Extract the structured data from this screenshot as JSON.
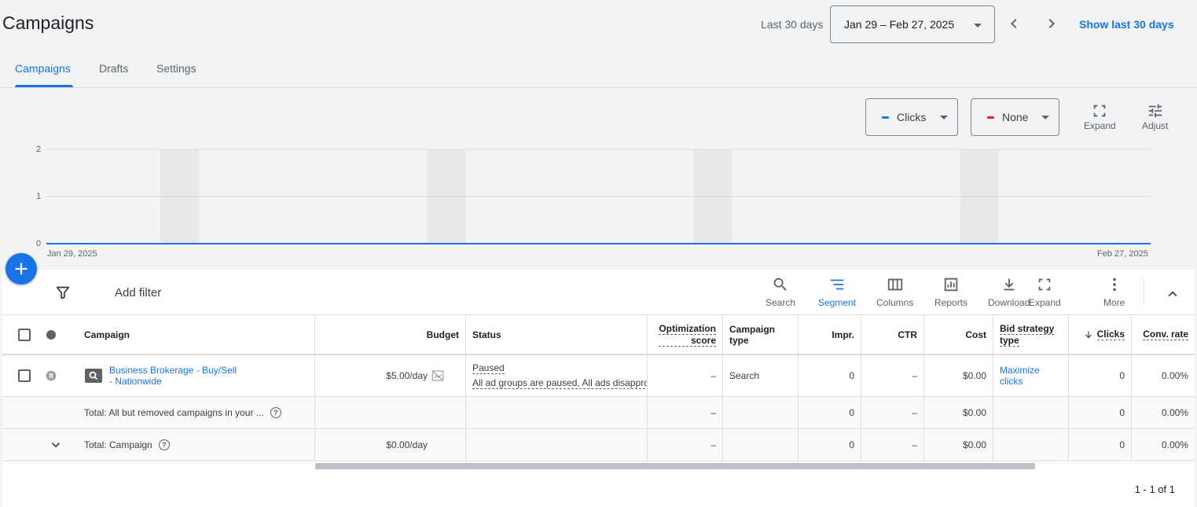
{
  "header": {
    "title": "Campaigns",
    "date_label": "Last 30 days",
    "date_range": "Jan 29 – Feb 27, 2025",
    "show_last": "Show last 30 days"
  },
  "tabs": [
    {
      "label": "Campaigns",
      "active": true
    },
    {
      "label": "Drafts",
      "active": false
    },
    {
      "label": "Settings",
      "active": false
    }
  ],
  "chart_controls": {
    "metric1": {
      "label": "Clicks",
      "color": "#1a73e8"
    },
    "metric2": {
      "label": "None",
      "color": "#d93025"
    },
    "expand_label": "Expand",
    "adjust_label": "Adjust"
  },
  "chart_data": {
    "type": "line",
    "x_start": "Jan 29, 2025",
    "x_end": "Feb 27, 2025",
    "y_ticks": [
      "2",
      "1",
      "0"
    ],
    "ylim": [
      0,
      2
    ],
    "series": [
      {
        "name": "Clicks",
        "color": "#1a73e8",
        "values": [
          0,
          0,
          0,
          0,
          0,
          0,
          0,
          0,
          0,
          0,
          0,
          0,
          0,
          0,
          0,
          0,
          0,
          0,
          0,
          0,
          0,
          0,
          0,
          0,
          0,
          0,
          0,
          0,
          0,
          0
        ]
      }
    ],
    "weekend_shading": true
  },
  "toolbar": {
    "add_filter": "Add filter",
    "buttons": [
      {
        "label": "Search",
        "icon": "search-icon"
      },
      {
        "label": "Segment",
        "icon": "segment-icon",
        "active": true
      },
      {
        "label": "Columns",
        "icon": "columns-icon"
      },
      {
        "label": "Reports",
        "icon": "reports-icon"
      },
      {
        "label": "Download",
        "icon": "download-icon"
      },
      {
        "label": "Expand",
        "icon": "expand-icon"
      },
      {
        "label": "More",
        "icon": "more-vert-icon"
      }
    ]
  },
  "table": {
    "headers": {
      "campaign": "Campaign",
      "budget": "Budget",
      "status": "Status",
      "opt_score_1": "Optimization",
      "opt_score_2": "score",
      "campaign_type_1": "Campaign",
      "campaign_type_2": "type",
      "impr": "Impr.",
      "ctr": "CTR",
      "cost": "Cost",
      "bid_1": "Bid strategy",
      "bid_2": "type",
      "clicks": "Clicks",
      "conv_rate": "Conv. rate"
    },
    "row": {
      "campaign_1": "Business Brokerage - Buy/Sell",
      "campaign_2": "- Nationwide",
      "budget": "$5.00/day",
      "status": "Paused",
      "status_detail": "All ad groups are paused, All ads disappro",
      "opt_score": "–",
      "campaign_type": "Search",
      "impr": "0",
      "ctr": "–",
      "cost": "$0.00",
      "bid_1": "Maximize",
      "bid_2": "clicks",
      "clicks": "0",
      "conv_rate": "0.00%"
    },
    "total_all": {
      "label": "Total: All but removed campaigns in your ...",
      "opt_score": "–",
      "impr": "0",
      "ctr": "–",
      "cost": "$0.00",
      "clicks": "0",
      "conv_rate": "0.00%"
    },
    "total_campaign": {
      "label": "Total: Campaign",
      "budget": "$0.00/day",
      "opt_score": "–",
      "impr": "0",
      "ctr": "–",
      "cost": "$0.00",
      "clicks": "0",
      "conv_rate": "0.00%"
    },
    "pagination": "1 - 1 of 1"
  }
}
